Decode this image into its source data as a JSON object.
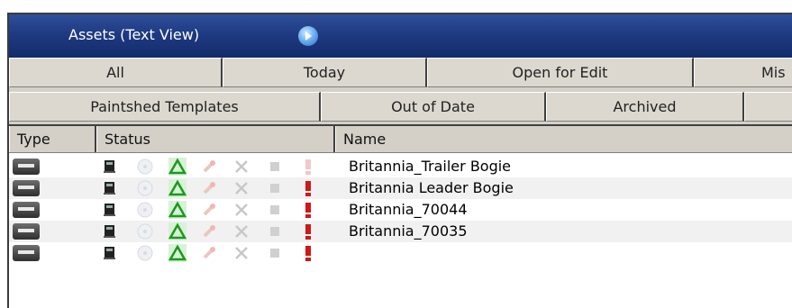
{
  "window": {
    "title": "Assets (Text View)"
  },
  "tabs_row1": [
    "All",
    "Today",
    "Open for Edit",
    "Mis"
  ],
  "tabs_row2": [
    "Paintshed Templates",
    "Out of Date",
    "Archived",
    ""
  ],
  "columns": {
    "type": "Type",
    "status": "Status",
    "name": "Name"
  },
  "icons": {
    "title_button": "info-play-icon",
    "type": "loco-asset-icon",
    "status": [
      "book-icon",
      "disc-icon",
      "triangle-icon",
      "wrench-icon",
      "tools-icon",
      "square-icon",
      "exclamation-icon"
    ]
  },
  "rows": [
    {
      "name": "Britannia_Trailer Bogie",
      "error_active": false
    },
    {
      "name": "Britannia Leader Bogie",
      "error_active": true
    },
    {
      "name": "Britannia_70044",
      "error_active": true
    },
    {
      "name": "Britannia_70035",
      "error_active": true
    },
    {
      "name": "",
      "error_active": true
    }
  ],
  "colors": {
    "title_bar": "#1e3a82",
    "triangle_green": "#1a9a1a",
    "error_red": "#d01818"
  }
}
